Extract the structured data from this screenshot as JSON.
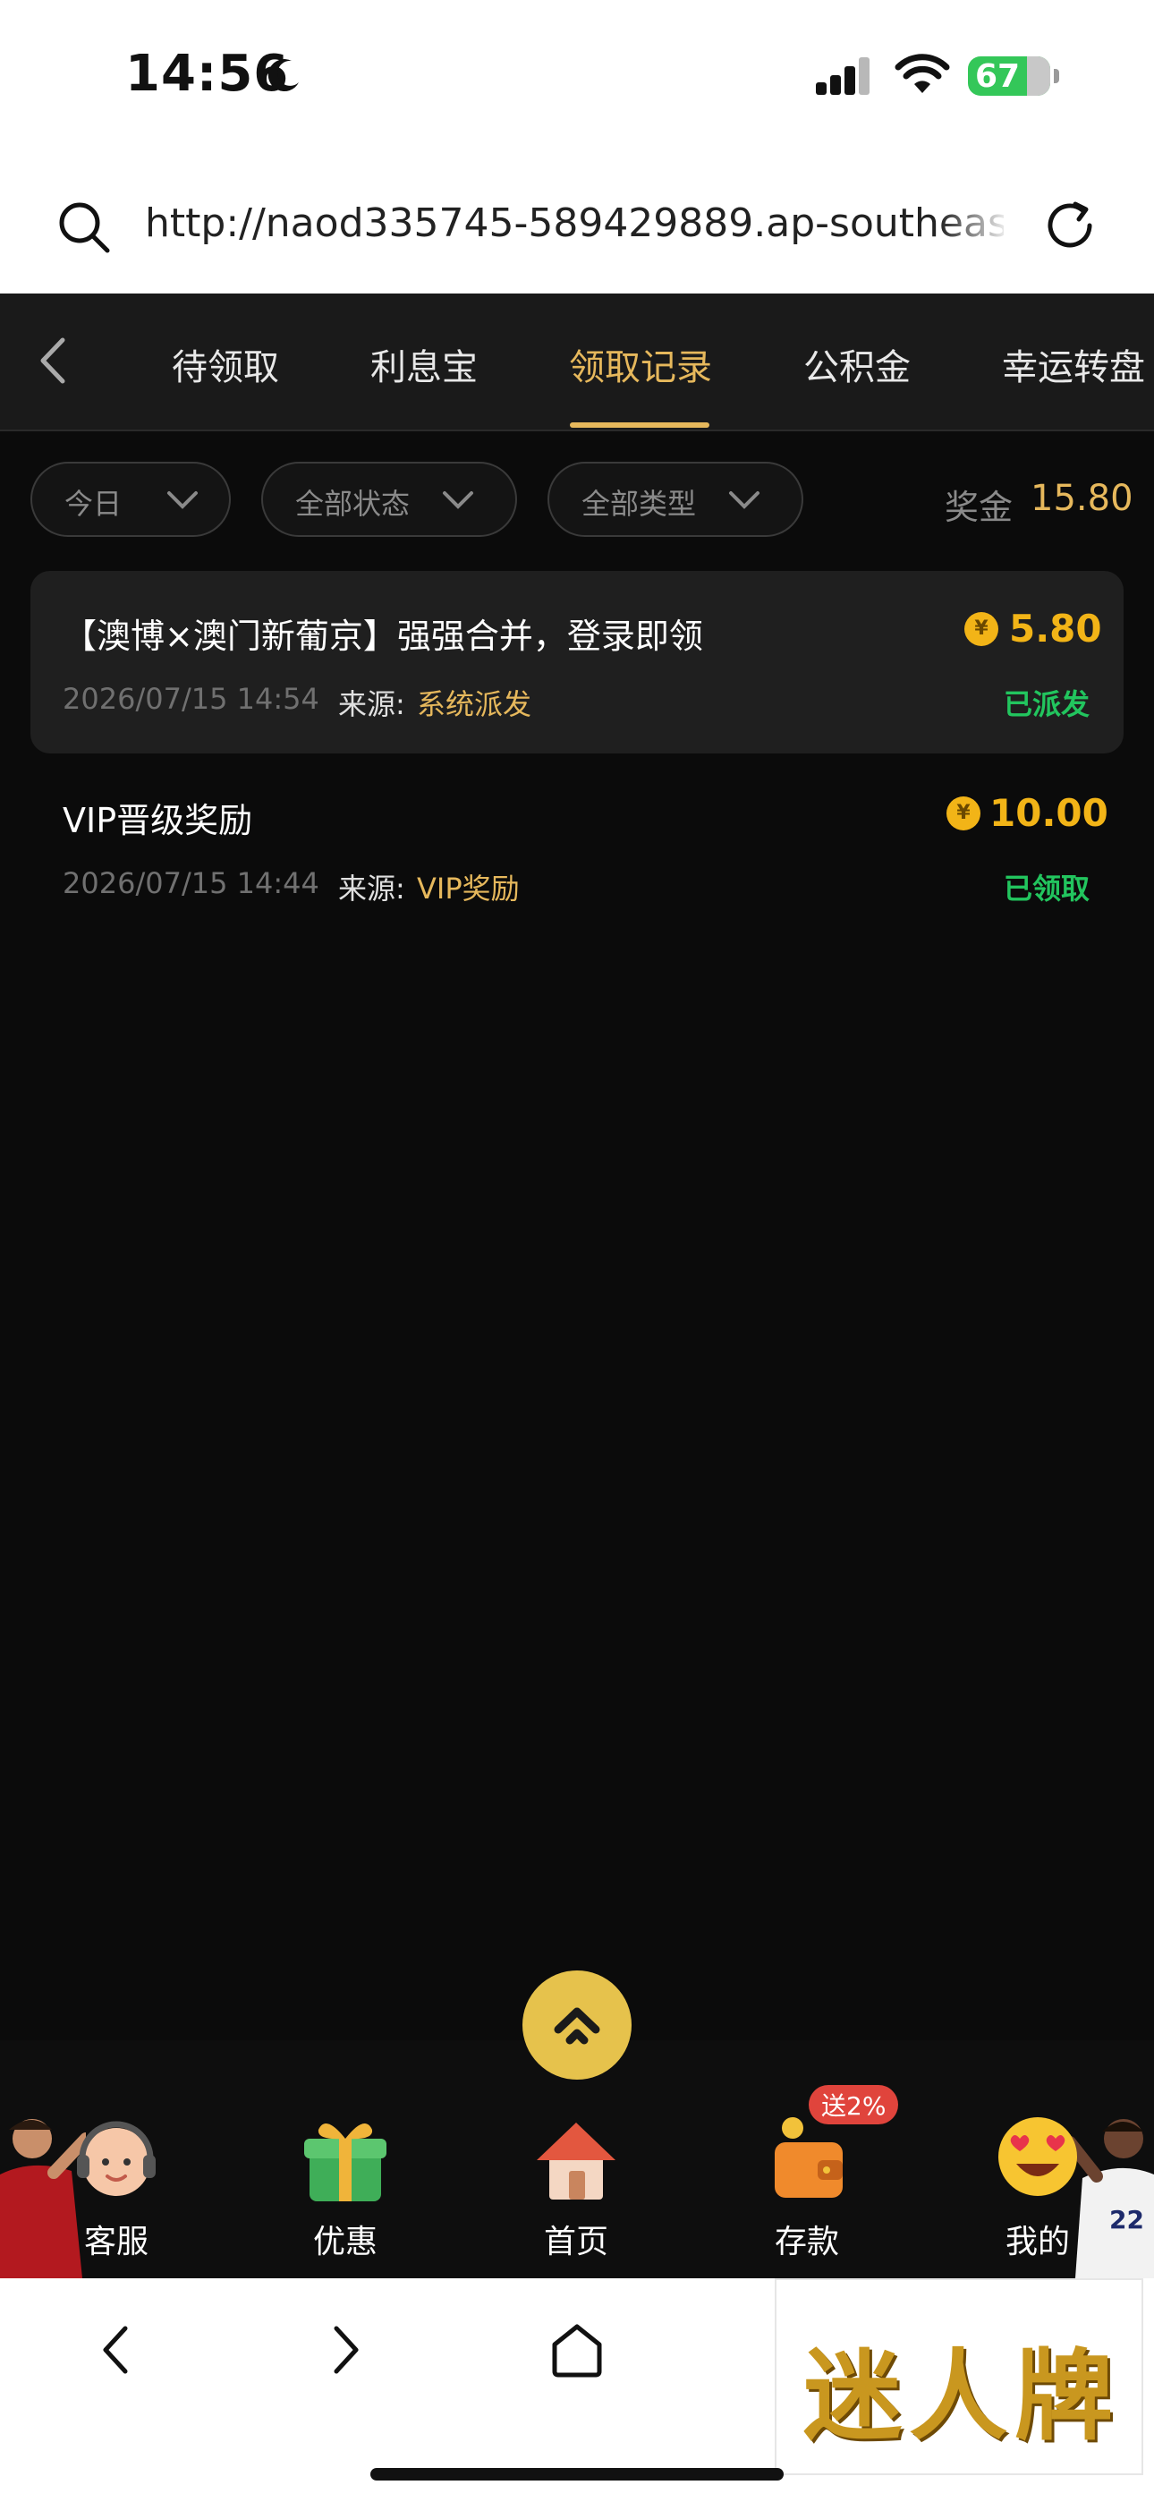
{
  "status_bar": {
    "time": "14:56",
    "battery": "67"
  },
  "browser": {
    "url": "http://naod335745-589429889.ap-southeast-"
  },
  "tabs": [
    "待领取",
    "利息宝",
    "领取记录",
    "公积金",
    "幸运转盘"
  ],
  "active_tab": "领取记录",
  "filters": {
    "date": "今日",
    "status": "全部状态",
    "type": "全部类型"
  },
  "bonus": {
    "label": "奖金",
    "value": "15.80"
  },
  "records": [
    {
      "title": "【澳博×澳门新葡京】强强合并，登录即领",
      "amount": "5.80",
      "date": "2026/07/15 14:54",
      "source_label": "来源:",
      "source": "系统派发",
      "status": "已派发"
    },
    {
      "title": "VIP晋级奖励",
      "amount": "10.00",
      "date": "2026/07/15 14:44",
      "source_label": "来源:",
      "source": "VIP奖励",
      "status": "已领取"
    }
  ],
  "currency_symbol": "¥",
  "bottom_nav": [
    {
      "label": "客服",
      "icon": "customer-service-icon"
    },
    {
      "label": "优惠",
      "icon": "gift-icon"
    },
    {
      "label": "首页",
      "icon": "home-icon"
    },
    {
      "label": "存款",
      "icon": "wallet-icon",
      "badge": "送2%"
    },
    {
      "label": "我的",
      "icon": "smiley-face-icon"
    }
  ],
  "brand_logo_text": "迷人牌",
  "colors": {
    "accent": "#e6b85c",
    "coin": "#f2b417",
    "success": "#22c55e",
    "badge": "#e0443c",
    "background": "#0b0b0b"
  }
}
